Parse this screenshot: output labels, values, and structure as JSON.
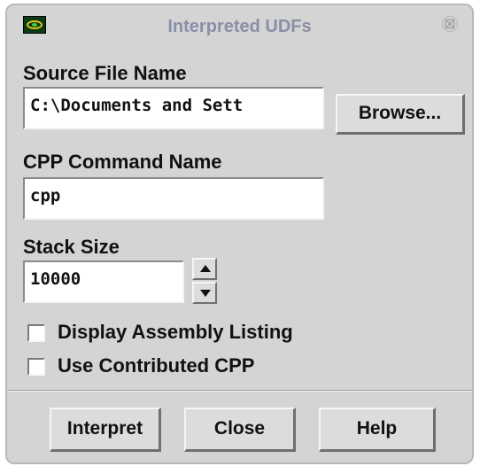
{
  "window": {
    "title": "Interpreted UDFs",
    "close_glyph": "⊠",
    "icon": "fluent-app-icon"
  },
  "source_file": {
    "label": "Source File Name",
    "value": "C:\\Documents and Sett",
    "browse_label": "Browse..."
  },
  "cpp_command": {
    "label": "CPP Command Name",
    "value": "cpp"
  },
  "stack_size": {
    "label": "Stack Size",
    "value": "10000"
  },
  "options": [
    {
      "label": "Display Assembly Listing",
      "checked": false
    },
    {
      "label": "Use Contributed CPP",
      "checked": false
    }
  ],
  "buttons": {
    "interpret": "Interpret",
    "close": "Close",
    "help": "Help"
  },
  "colors": {
    "window_bg": "#d4d4d4",
    "title_text": "#8a8fa8",
    "field_bg": "#ffffff"
  }
}
